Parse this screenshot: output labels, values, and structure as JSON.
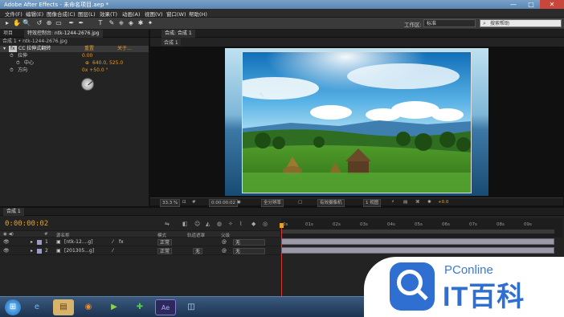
{
  "window": {
    "title": "Adobe After Effects - 未命名项目.aep *",
    "controls": [
      "—",
      "□",
      "✕"
    ]
  },
  "menu": [
    "文件(F)",
    "编辑(E)",
    "图像合成(C)",
    "图层(L)",
    "效果(T)",
    "动画(A)",
    "视图(V)",
    "窗口(W)",
    "帮助(H)"
  ],
  "toolbar": {
    "tools": [
      "▸",
      "✋",
      "🔍",
      "↺",
      "⊕",
      "▭",
      "✒",
      "T",
      "✎",
      "⎈",
      "◈",
      "✱",
      "✦"
    ],
    "workspace_label": "工作区:",
    "workspace_value": "标准",
    "search_placeholder": "搜索帮助"
  },
  "left_panel": {
    "tabs": [
      "项目",
      "特效控制台: ntk-1244-2676.jpg"
    ],
    "header": "合成 1 • ntk-1244-2676.jpg",
    "effect_name": "CC 拉伸式翻转",
    "reset_label": "重置",
    "about_label": "关于...",
    "props": [
      {
        "name": "拉伸",
        "value": "0.00"
      },
      {
        "name": "中心",
        "value": "640.0, 525.0"
      },
      {
        "name": "方向",
        "value": "0x +50.0 °"
      }
    ]
  },
  "viewer": {
    "tabs": [
      "合成: 合成 1"
    ],
    "subtab": "合成 1",
    "bar": {
      "zoom": "33.3 %",
      "timecode": "0:00:00:02",
      "resolution": "全分辨率",
      "camera": "有效摄像机",
      "views": "1 视图",
      "exposure": "+0.0"
    }
  },
  "timeline": {
    "tab": "合成 1",
    "current_time": "0:00:00:02",
    "columns": {
      "num": "#",
      "source": "源名称",
      "mode": "模式",
      "trkmat": "轨道遮罩",
      "parent": "父级"
    },
    "layers": [
      {
        "num": "1",
        "name": "[ntk-12....g]",
        "mode": "正常",
        "trkmat": "",
        "parent": "无"
      },
      {
        "num": "2",
        "name": "[201305...g]",
        "mode": "正常",
        "trkmat": "无",
        "parent": "无"
      }
    ],
    "ruler": [
      "0s",
      "01s",
      "02s",
      "03s",
      "04s",
      "05s",
      "06s",
      "07s",
      "08s",
      "09s"
    ]
  },
  "taskbar": {
    "start": "⊞",
    "apps": [
      "IE",
      "Explorer",
      "Firefox",
      "Media",
      "360",
      "Ae",
      "Win"
    ]
  },
  "watermark": {
    "line1": "PConline",
    "line2": "IT百科"
  },
  "colors": {
    "accent_orange": "#e29b2b",
    "panel": "#232323",
    "watermark_blue": "#2f6fd1"
  }
}
